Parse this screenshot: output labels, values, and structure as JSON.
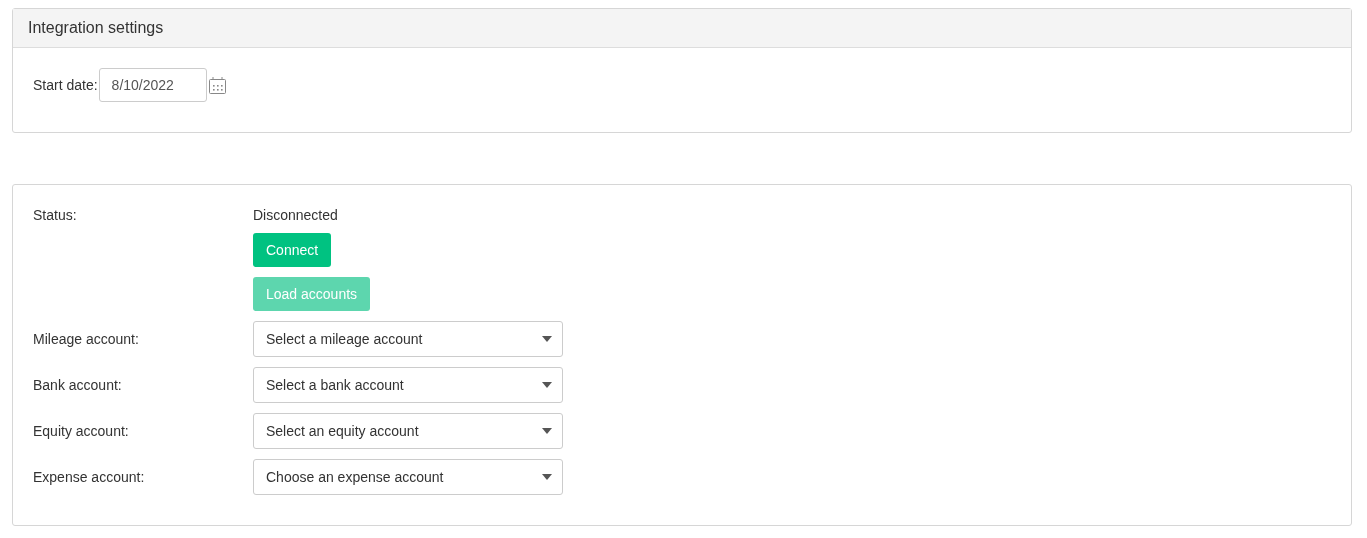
{
  "settings_panel": {
    "title": "Integration settings",
    "start_date": {
      "label": "Start date:",
      "value": "8/10/2022"
    }
  },
  "connection_panel": {
    "status": {
      "label": "Status:",
      "value": "Disconnected"
    },
    "buttons": [
      {
        "label": "Connect",
        "disabled": false
      },
      {
        "label": "Load accounts",
        "disabled": true
      }
    ],
    "accounts": [
      {
        "label": "Mileage account:",
        "placeholder": "Select a mileage account"
      },
      {
        "label": "Bank account:",
        "placeholder": "Select a bank account"
      },
      {
        "label": "Equity account:",
        "placeholder": "Select an equity account"
      },
      {
        "label": "Expense account:",
        "placeholder": "Choose an expense account"
      }
    ]
  }
}
